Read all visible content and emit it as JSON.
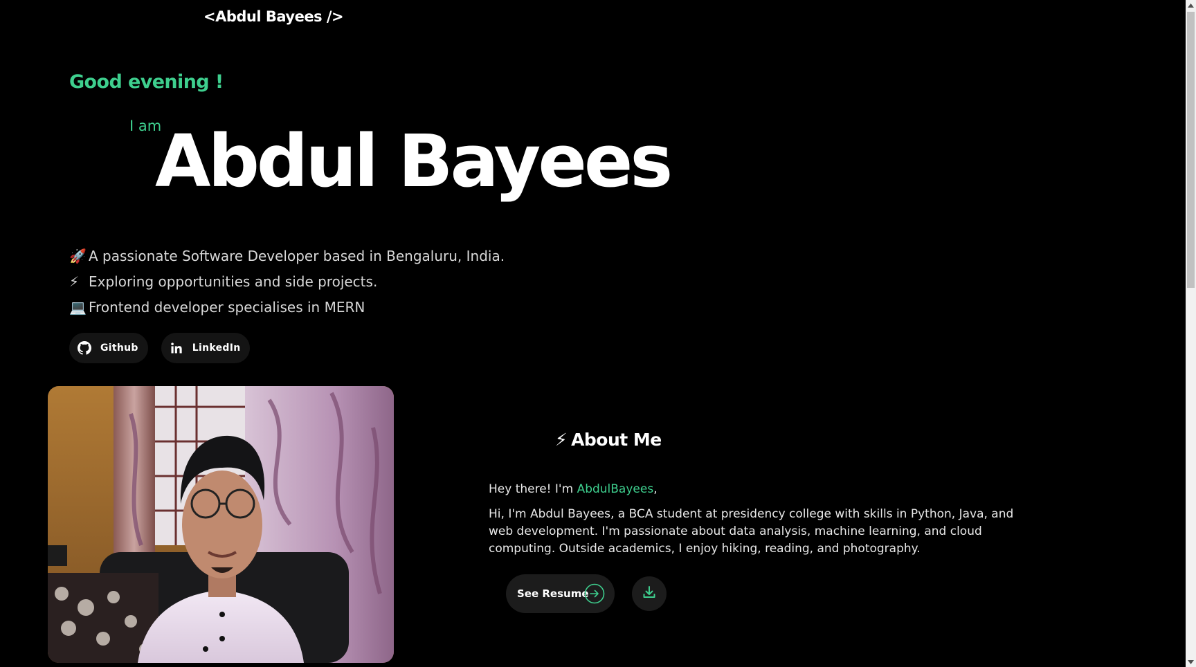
{
  "header": {
    "logo_text": "<Abdul Bayees />"
  },
  "hero": {
    "greeting": "Good evening !",
    "intro_prefix": "I am",
    "name": "Abdul Bayees",
    "bullets": [
      {
        "icon": "rocket-icon",
        "emoji": "🚀",
        "text": "A passionate Software Developer based in Bengaluru, India."
      },
      {
        "icon": "lightning-icon",
        "emoji": "⚡",
        "text": "Exploring opportunities and side projects."
      },
      {
        "icon": "laptop-icon",
        "emoji": "💻",
        "text": "Frontend developer specialises in MERN"
      }
    ],
    "socials": [
      {
        "icon": "github-icon",
        "label": "Github"
      },
      {
        "icon": "linkedin-icon",
        "label": "LinkedIn"
      }
    ]
  },
  "about": {
    "title_emoji": "⚡",
    "title": "About Me",
    "hey_prefix": "Hey there! I'm ",
    "hey_name": "AbdulBayees",
    "hey_suffix": ",",
    "body": "Hi, I'm Abdul Bayees, a BCA student at presidency college with skills in Python, Java, and web development. I'm passionate about data analysis, machine learning, and cloud computing. Outside academics, I enjoy hiking, reading, and photography.",
    "resume_label": "See Resume",
    "resume_icon": "arrow-right-circle-icon",
    "download_icon": "download-icon"
  },
  "colors": {
    "background": "#000000",
    "accent": "#3ecf8e",
    "text": "#ffffff",
    "button_bg": "#1c1c1c"
  }
}
